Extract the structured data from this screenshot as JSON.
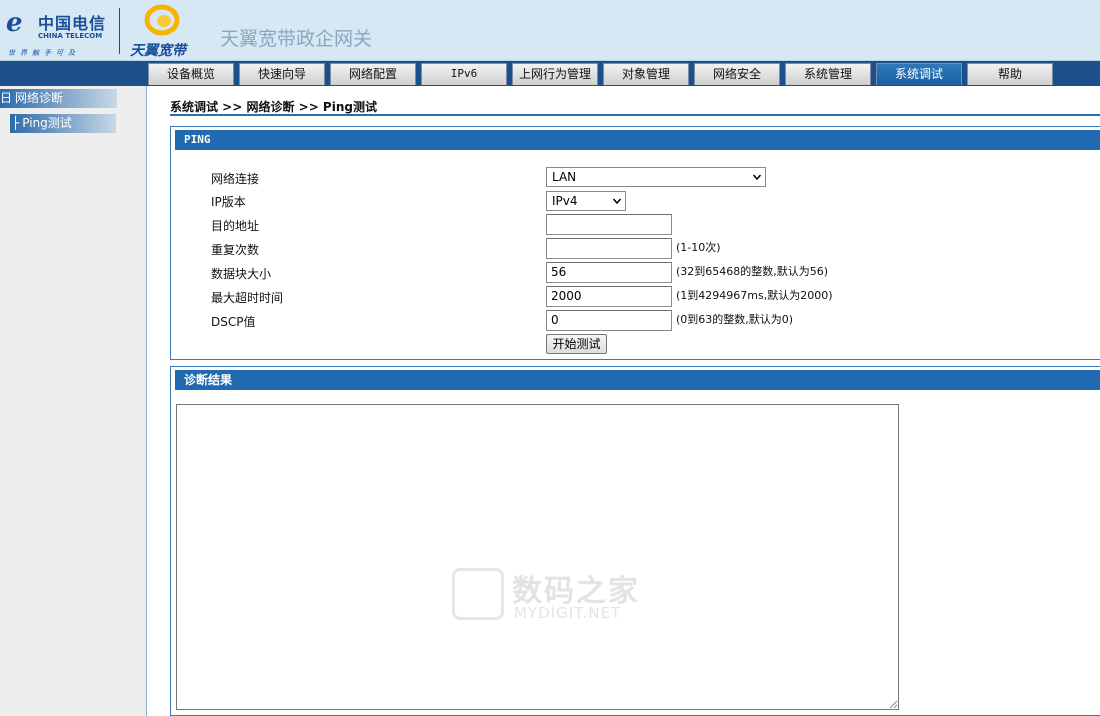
{
  "header": {
    "ct_logo_cn": "中国电信",
    "ct_logo_en": "CHINA TELECOM",
    "ct_slogan": "世界触手可及",
    "ty_logo": "天翼宽带",
    "title": "天翼宽带政企网关"
  },
  "nav": {
    "tabs": [
      "设备概览",
      "快速向导",
      "网络配置",
      "IPv6",
      "上网行为管理",
      "对象管理",
      "网络安全",
      "系统管理",
      "系统调试",
      "帮助"
    ],
    "active": "系统调试"
  },
  "sidebar": {
    "group": {
      "symbol": "日",
      "label": "网络诊断"
    },
    "item": {
      "symbol": "├",
      "label": "Ping测试"
    }
  },
  "breadcrumb": "系统调试 >> 网络诊断 >> Ping测试",
  "ping": {
    "title": "PING",
    "fields": {
      "connection": {
        "label": "网络连接",
        "value": "LAN"
      },
      "ip_version": {
        "label": "IP版本",
        "value": "IPv4"
      },
      "destination": {
        "label": "目的地址",
        "value": ""
      },
      "repeat": {
        "label": "重复次数",
        "value": "",
        "hint": "(1-10次)"
      },
      "size": {
        "label": "数据块大小",
        "value": "56",
        "hint": "(32到65468的整数,默认为56)"
      },
      "timeout": {
        "label": "最大超时时间",
        "value": "2000",
        "hint": "(1到4294967ms,默认为2000)"
      },
      "dscp": {
        "label": "DSCP值",
        "value": "0",
        "hint": "(0到63的整数,默认为0)"
      }
    },
    "start_button": "开始测试"
  },
  "result": {
    "title": "诊断结果",
    "content": ""
  },
  "watermark": {
    "cn": "数码之家",
    "en": "MYDIGIT.NET"
  },
  "colors": {
    "nav_bg": "#1d4f8a",
    "section_head": "#1f6ab0",
    "header_bg": "#d6e8f4"
  }
}
